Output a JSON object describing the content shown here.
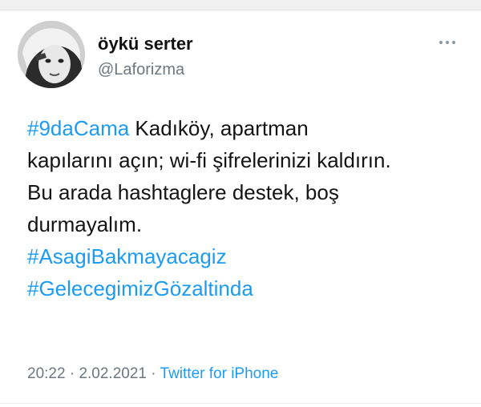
{
  "tweet": {
    "author": {
      "display_name": "öykü serter",
      "handle": "@Laforizma"
    },
    "more_icon": "more-horizontal-icon",
    "lines": [
      [
        {
          "text": "#9daCama",
          "hashtag": true
        },
        {
          "text": " Kadıköy, apartman",
          "hashtag": false
        }
      ],
      [
        {
          "text": "kapılarını açın; wi-fi şifrelerinizi kaldırın.",
          "hashtag": false
        }
      ],
      [
        {
          "text": "Bu arada hashtaglere destek, boş",
          "hashtag": false
        }
      ],
      [
        {
          "text": "durmayalım.",
          "hashtag": false
        }
      ],
      [
        {
          "text": "#AsagiBakmayacagiz",
          "hashtag": true
        }
      ],
      [
        {
          "text": "#GelecegimizGözaltinda",
          "hashtag": true
        }
      ]
    ],
    "time": "20:22",
    "separator": " · ",
    "date": "2.02.2021",
    "source": "Twitter for iPhone",
    "colors": {
      "link": "#1d9bf0",
      "muted": "#6e767d",
      "text": "#141414"
    }
  }
}
